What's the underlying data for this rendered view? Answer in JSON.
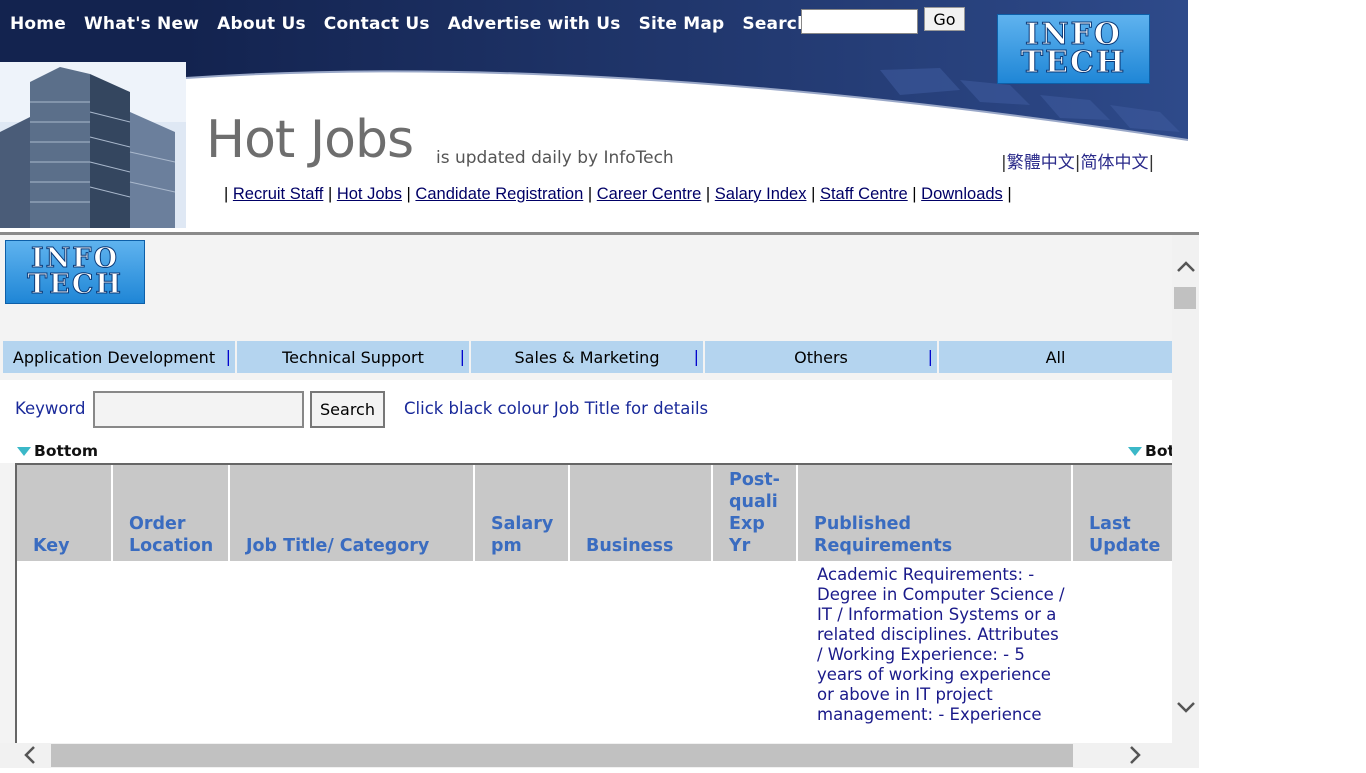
{
  "header": {
    "nav": [
      "Home",
      "What's New",
      "About Us",
      "Contact Us",
      "Advertise with Us",
      "Site Map",
      "Search"
    ],
    "go_label": "Go",
    "logo_line1": "INFO",
    "logo_line2": "TECH",
    "title": "Hot Jobs",
    "subtitle": "is updated daily by InfoTech",
    "lang": {
      "traditional": "繁體中文",
      "simplified": "简体中文"
    },
    "subnav": [
      "Recruit Staff",
      "Hot Jobs",
      "Candidate Registration",
      "Career Centre",
      "Salary Index",
      "Staff Centre",
      "Downloads"
    ]
  },
  "content": {
    "logo_line1": "INFO",
    "logo_line2": "TECH",
    "categories": [
      "Application Development",
      "Technical Support",
      "Sales & Marketing",
      "Others",
      "All"
    ],
    "category_separator": "|",
    "keyword_label": "Keyword",
    "search_label": "Search",
    "hint": "Click black colour Job Title for details",
    "bottom_label": "Bottom",
    "bottom_label_right": "Bot"
  },
  "table": {
    "headers": [
      "Key",
      "Order Location",
      "Job Title/ Category",
      "Salary pm",
      "Business",
      "Post-quali Exp Yr",
      "Published Requirements",
      "Last Update"
    ],
    "rows": [
      {
        "requirements": "Academic Requirements: - Degree in Computer Science / IT / Information Systems or a related disciplines. Attributes / Working Experience: - 5 years of working experience or above in IT project management: - Experience"
      }
    ]
  },
  "colors": {
    "nav_band": "#13234f",
    "tab_bg": "#b4d4ef",
    "header_text": "#3a6cc0",
    "link_blue": "#1a2a9a"
  }
}
